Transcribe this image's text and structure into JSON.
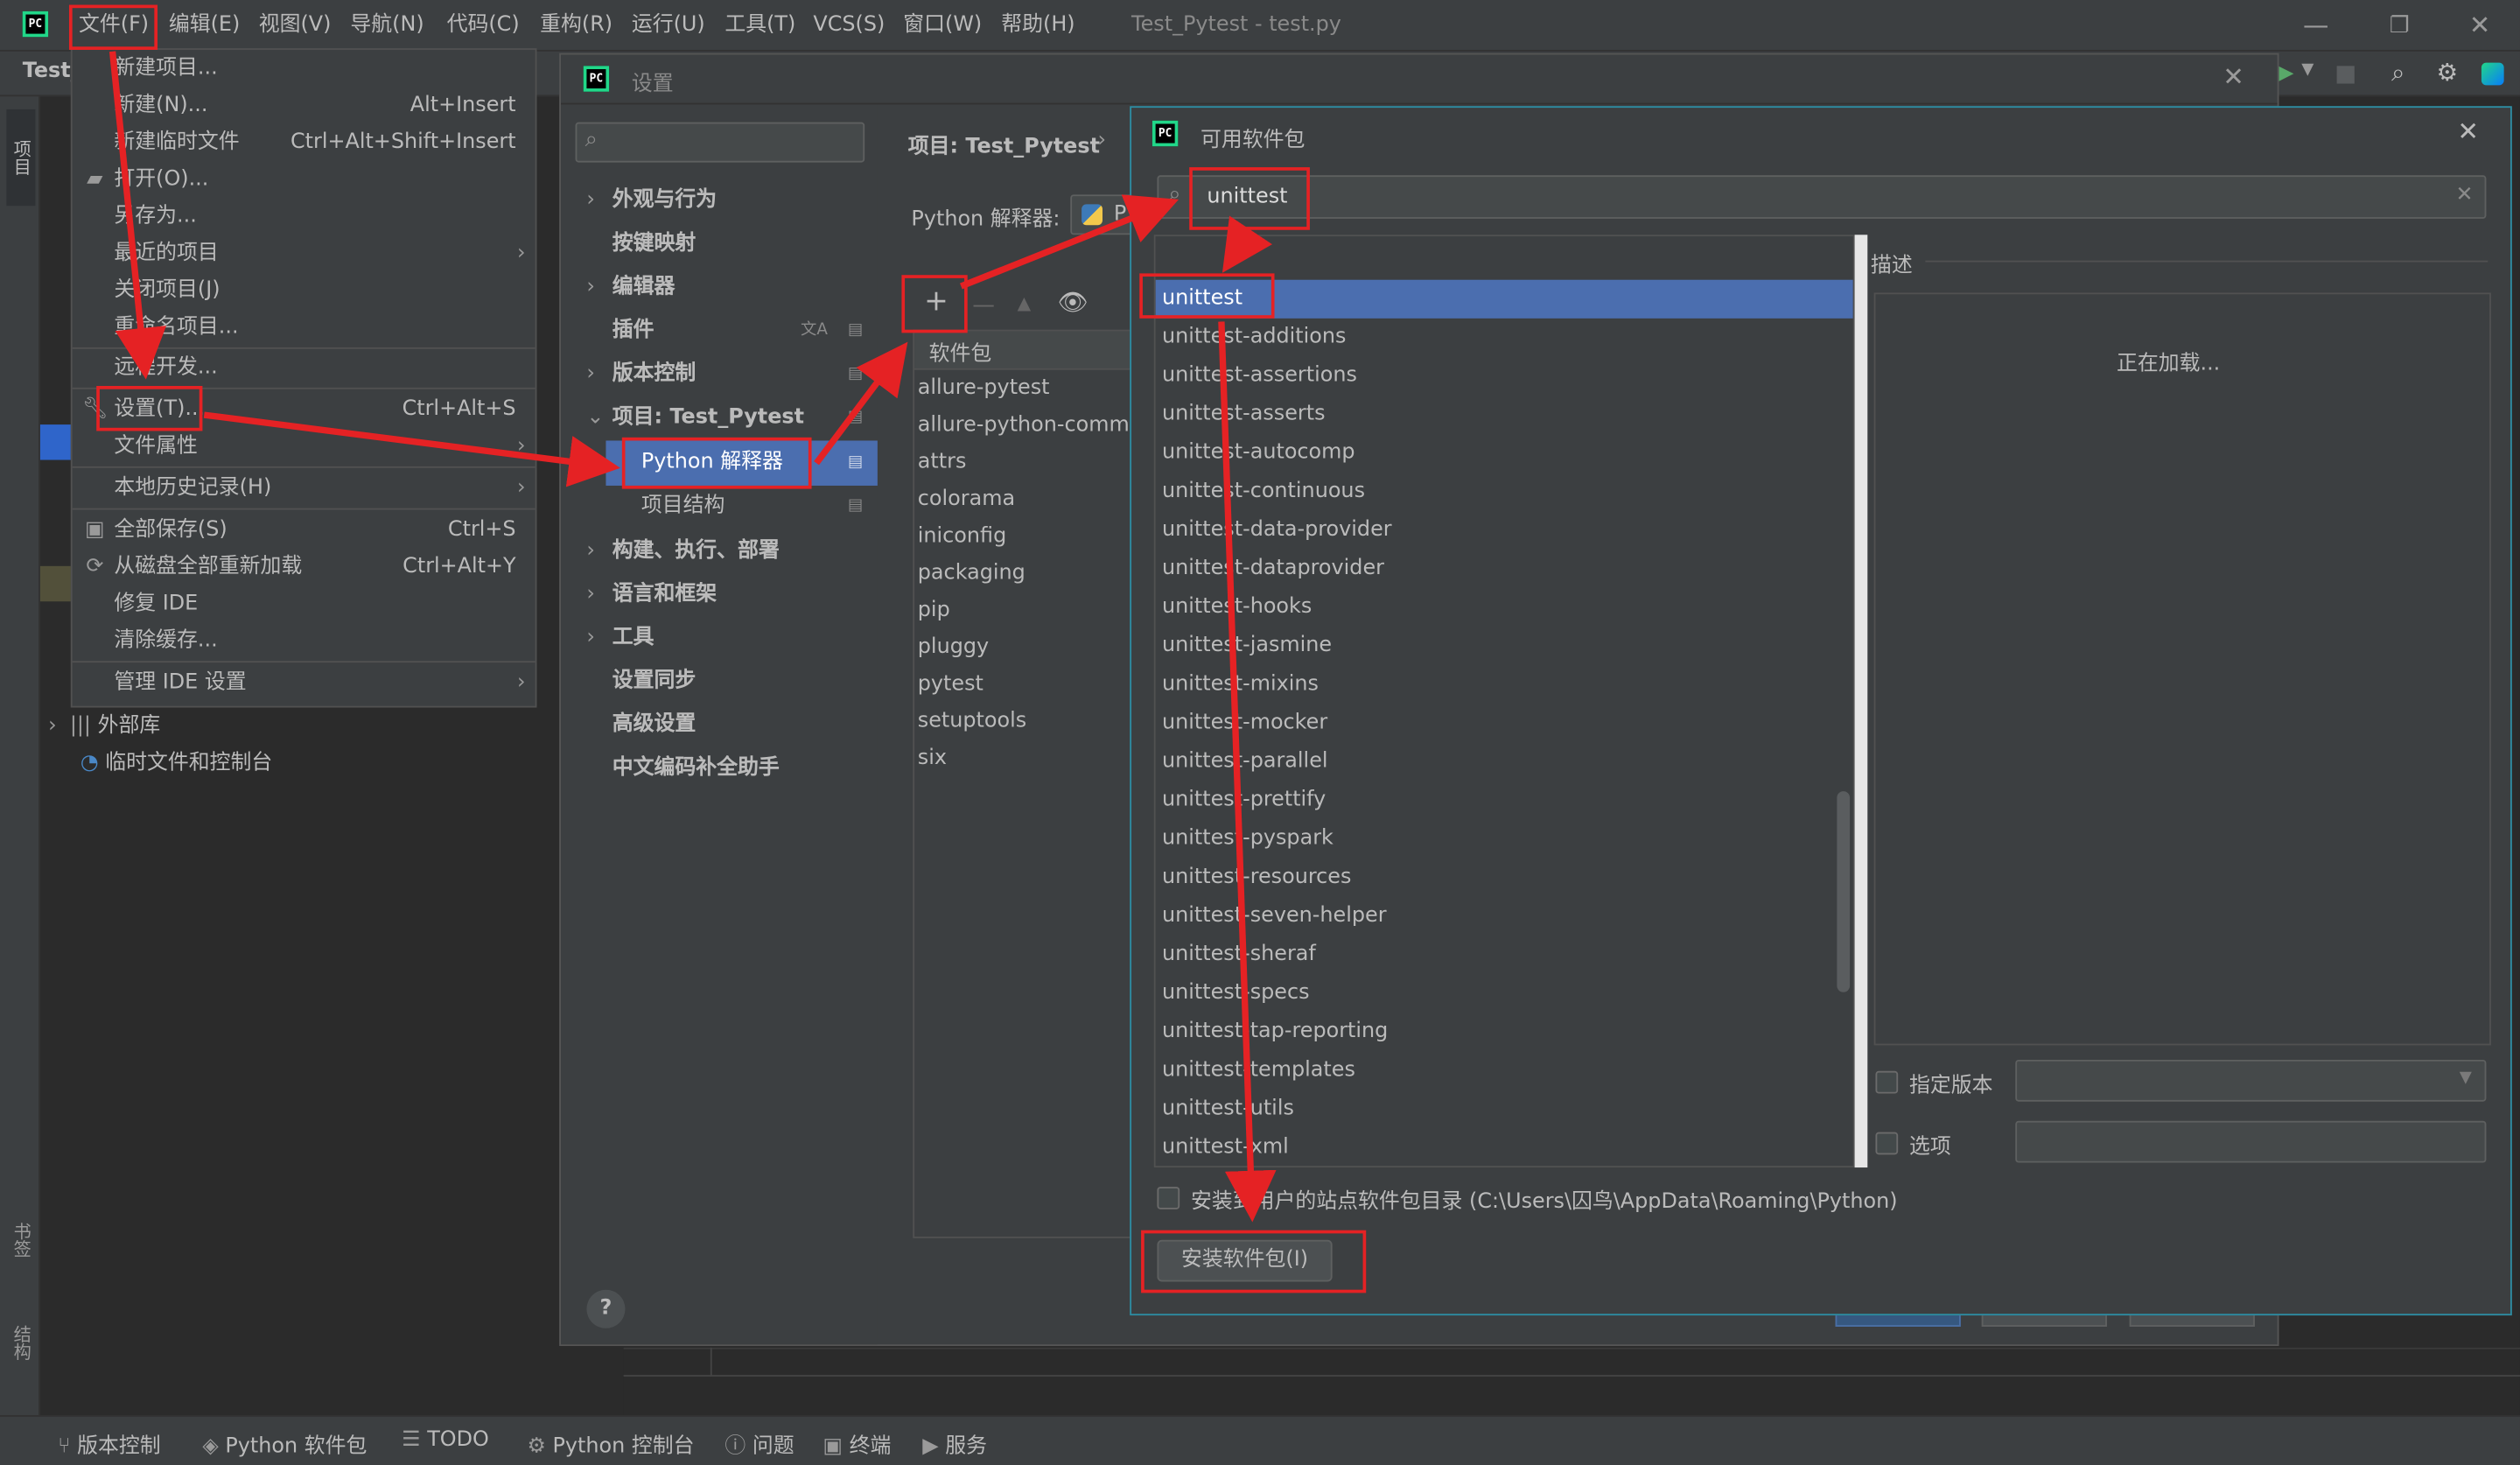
{
  "titlebar": {
    "menus": [
      "文件(F)",
      "编辑(E)",
      "视图(V)",
      "导航(N)",
      "代码(C)",
      "重构(R)",
      "运行(U)",
      "工具(T)",
      "VCS(S)",
      "窗口(W)",
      "帮助(H)"
    ],
    "window_title": "Test_Pytest - test.py",
    "app_logo": "PC"
  },
  "project_tab": "Test_",
  "side_tabs": {
    "project": "项目",
    "bookmarks": "书签",
    "structure": "结构"
  },
  "file_menu": {
    "items": [
      {
        "label": "新建项目...",
        "shortcut": ""
      },
      {
        "label": "新建(N)...",
        "shortcut": "Alt+Insert"
      },
      {
        "label": "新建临时文件",
        "shortcut": "Ctrl+Alt+Shift+Insert"
      },
      {
        "label": "打开(O)...",
        "shortcut": ""
      },
      {
        "label": "另存为...",
        "shortcut": ""
      },
      {
        "label": "最近的项目",
        "shortcut": ""
      },
      {
        "label": "关闭项目(J)",
        "shortcut": ""
      },
      {
        "label": "重命名项目...",
        "shortcut": ""
      },
      {
        "label": "远程开发...",
        "shortcut": ""
      },
      {
        "label": "设置(T)...",
        "shortcut": "Ctrl+Alt+S"
      },
      {
        "label": "文件属性",
        "shortcut": ""
      },
      {
        "label": "本地历史记录(H)",
        "shortcut": ""
      },
      {
        "label": "全部保存(S)",
        "shortcut": "Ctrl+S"
      },
      {
        "label": "从磁盘全部重新加载",
        "shortcut": "Ctrl+Alt+Y"
      },
      {
        "label": "修复 IDE",
        "shortcut": ""
      },
      {
        "label": "清除缓存...",
        "shortcut": ""
      },
      {
        "label": "管理 IDE 设置",
        "shortcut": ""
      }
    ]
  },
  "project_tree": {
    "external_libs": "外部库",
    "scratches": "临时文件和控制台"
  },
  "settings_dialog": {
    "title": "设置",
    "breadcrumb": "项目: Test_Pytest",
    "interpreter_label": "Python 解释器:",
    "interpreter_value": "P",
    "nav": [
      {
        "label": "外观与行为",
        "expand": "›"
      },
      {
        "label": "按键映射",
        "expand": ""
      },
      {
        "label": "编辑器",
        "expand": "›"
      },
      {
        "label": "插件",
        "expand": ""
      },
      {
        "label": "版本控制",
        "expand": "›"
      },
      {
        "label": "项目: Test_Pytest",
        "expand": "⌄"
      },
      {
        "label": "Python 解释器",
        "expand": ""
      },
      {
        "label": "项目结构",
        "expand": ""
      },
      {
        "label": "构建、执行、部署",
        "expand": "›"
      },
      {
        "label": "语言和框架",
        "expand": "›"
      },
      {
        "label": "工具",
        "expand": "›"
      },
      {
        "label": "设置同步",
        "expand": ""
      },
      {
        "label": "高级设置",
        "expand": ""
      },
      {
        "label": "中文编码补全助手",
        "expand": ""
      }
    ],
    "package_header": "软件包",
    "packages": [
      "allure-pytest",
      "allure-python-commo",
      "attrs",
      "colorama",
      "iniconfig",
      "packaging",
      "pip",
      "pluggy",
      "pytest",
      "setuptools",
      "six"
    ],
    "help": "?"
  },
  "available_packages": {
    "title": "可用软件包",
    "search_value": "unittest",
    "description_label": "描述",
    "loading_text": "正在加载...",
    "results": [
      "unittest",
      "unittest-additions",
      "unittest-assertions",
      "unittest-asserts",
      "unittest-autocomp",
      "unittest-continuous",
      "unittest-data-provider",
      "unittest-dataprovider",
      "unittest-hooks",
      "unittest-jasmine",
      "unittest-mixins",
      "unittest-mocker",
      "unittest-parallel",
      "unittest-prettify",
      "unittest-pyspark",
      "unittest-resources",
      "unittest-seven-helper",
      "unittest-sheraf",
      "unittest-specs",
      "unittest-tap-reporting",
      "unittest-templates",
      "unittest-utils",
      "unittest-xml"
    ],
    "specify_version_label": "指定版本",
    "options_label": "选项",
    "install_to_user_label": "安装到用户的站点软件包目录 (C:\\Users\\囚鸟\\AppData\\Roaming\\Python)",
    "install_button": "安装软件包(I)"
  },
  "statusbar": {
    "items": [
      {
        "icon": "branch-icon",
        "label": "版本控制"
      },
      {
        "icon": "layers-icon",
        "label": "Python 软件包"
      },
      {
        "icon": "list-icon",
        "label": "TODO"
      },
      {
        "icon": "python-icon",
        "label": "Python 控制台"
      },
      {
        "icon": "info-icon",
        "label": "问题"
      },
      {
        "icon": "terminal-icon",
        "label": "终端"
      },
      {
        "icon": "play-icon",
        "label": "服务"
      }
    ]
  },
  "colors": {
    "selection": "#4b6eaf",
    "highlight": "#e52224",
    "dialog_border": "#2d8da3"
  }
}
